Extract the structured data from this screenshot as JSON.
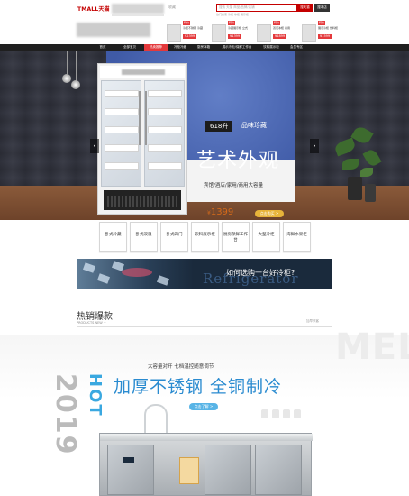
{
  "topbar": {
    "tmall_logo": "TMALL天猫",
    "favorite": "收藏",
    "search_placeholder": "搜索 天猫 商品/品牌/店铺",
    "search_tmall_label": "搜天猫",
    "search_shop_label": "搜本店",
    "hot_words": "热门搜索 冷柜 冰柜 展示柜"
  },
  "promos": [
    {
      "badge": "特价",
      "name": "冷柜不锈钢 冷藏",
      "price": "¥2399"
    },
    {
      "badge": "特价",
      "name": "冷藏展示柜 立式",
      "price": "¥1399"
    },
    {
      "badge": "特价",
      "name": "双门冰柜 商用",
      "price": "¥1899"
    },
    {
      "badge": "特价",
      "name": "展示冷柜 饮料柜",
      "price": "¥1599"
    }
  ],
  "nav": [
    {
      "label": "首页"
    },
    {
      "label": "全部宝贝"
    },
    {
      "label": "热卖推荐"
    },
    {
      "label": "冷柜冷藏"
    },
    {
      "label": "厨房冰箱"
    },
    {
      "label": "展示冷柜/保鲜工作台"
    },
    {
      "label": "饮料展示柜"
    },
    {
      "label": "会员专区"
    }
  ],
  "hero": {
    "capacity_tag": "618升",
    "quality_tag": "品味珍藏",
    "title": "艺术外观",
    "subtitle": "宾馆/酒店/家用/商用大容量",
    "price_currency": "¥",
    "price": "1399",
    "cta": "点击购买 >",
    "prev_arrow": "‹",
    "next_arrow": "›"
  },
  "categories": [
    {
      "label": "卧式冷藏"
    },
    {
      "label": "卧式双温"
    },
    {
      "label": "卧式四门"
    },
    {
      "label": "饮料展示柜"
    },
    {
      "label": "厨房保鲜工作台"
    },
    {
      "label": "大型冷柜"
    },
    {
      "label": "海鲜水果柜"
    }
  ],
  "howto": {
    "text": "如何选购一台好冷柜?",
    "watermark": "Refrigerator"
  },
  "hot": {
    "title": "热销爆款",
    "subtitle": "PRODUCTS NEW +",
    "more": "加早采客",
    "watermark": "MEL"
  },
  "product": {
    "year": "2019",
    "hot_label": "HOT",
    "subtitle": "大容量对开 七档温控随意调节",
    "title": "加厚不锈钢 全铜制冷",
    "cta": "点击了解 >"
  },
  "colors": {
    "tmall_red": "#c40000",
    "promo_red": "#e4393c",
    "hero_blue": "#3f5aa6",
    "price_orange": "#d46a1a",
    "product_blue": "#2a8bd0"
  }
}
